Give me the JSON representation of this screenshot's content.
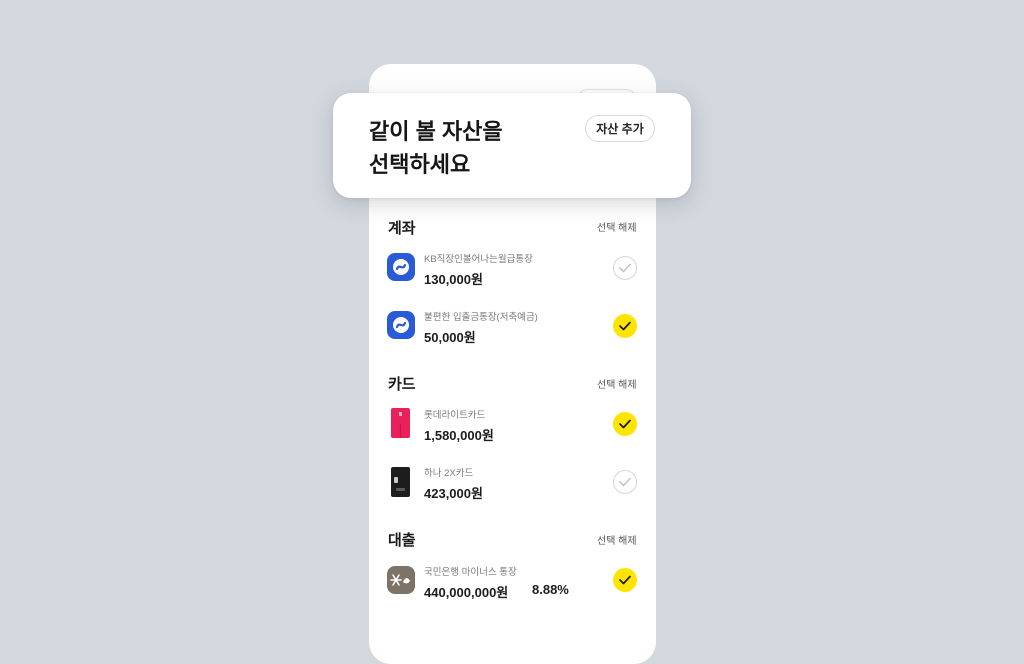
{
  "header": {
    "title_line1": "같이 볼 자산을",
    "title_line2": "선택하세요",
    "add_button_label": "자산 추가"
  },
  "deselect_label": "선택 해제",
  "sections": {
    "accounts": {
      "title": "계좌",
      "items": [
        {
          "name": "KB직장인볼어나는월급통장",
          "amount": "130,000원",
          "checked": false,
          "icon": "kb-bank-icon"
        },
        {
          "name": "불편한 입출금통장(저축예금)",
          "amount": "50,000원",
          "checked": true,
          "icon": "kb-bank-icon"
        }
      ]
    },
    "cards": {
      "title": "카드",
      "items": [
        {
          "name": "롯데라이트카드",
          "amount": "1,580,000원",
          "checked": true,
          "icon": "red-card-icon"
        },
        {
          "name": "하나 2X카드",
          "amount": "423,000원",
          "checked": false,
          "icon": "black-card-icon"
        }
      ]
    },
    "loans": {
      "title": "대출",
      "items": [
        {
          "name": "국민은행 마이너스 통장",
          "amount": "440,000,000원",
          "rate": "8.88%",
          "checked": true,
          "icon": "kb-loan-icon"
        }
      ]
    }
  },
  "colors": {
    "background": "#d3d8de",
    "check_active": "#fde500",
    "bank_blue": "#2a5bd7",
    "card_red": "#e8215b",
    "loan_brown": "#7d7366"
  }
}
